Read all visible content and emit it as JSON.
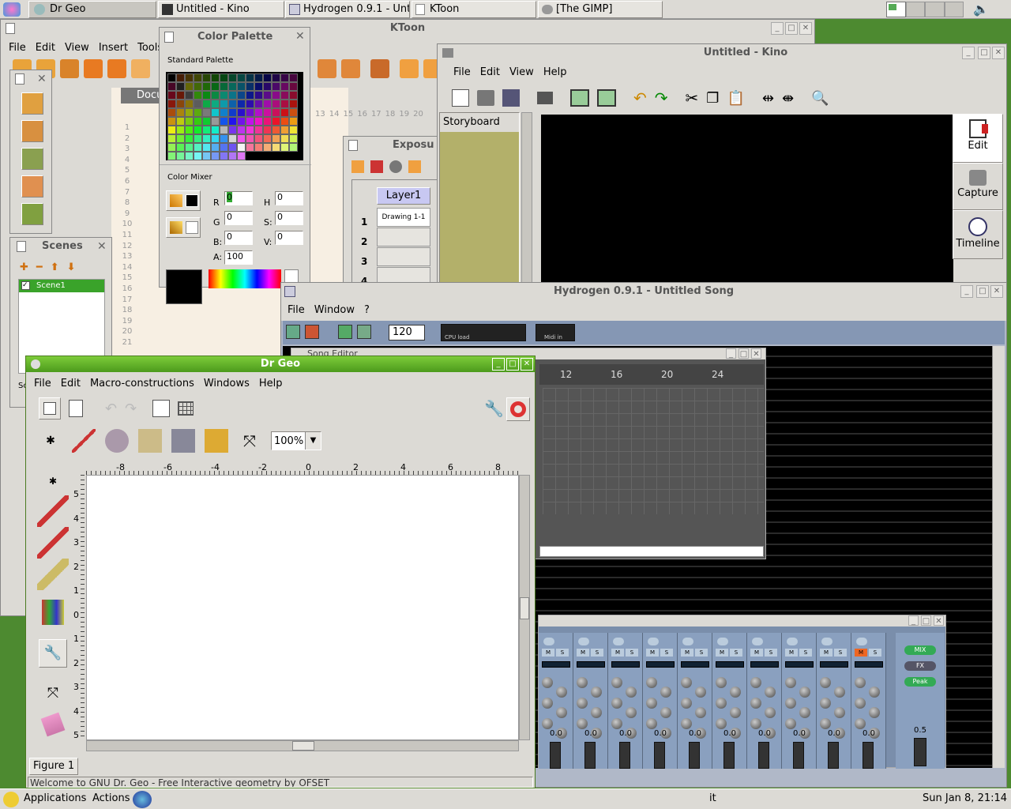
{
  "taskbar": {
    "tasks": [
      "Dr Geo",
      "Untitled - Kino",
      "Hydrogen 0.9.1 - Unt",
      "KToon",
      "[The GIMP]"
    ]
  },
  "ktoon": {
    "title": "KToon",
    "menu": [
      "File",
      "Edit",
      "View",
      "Insert",
      "Tools"
    ],
    "doc_tab": "Docu",
    "scenes_title": "Scenes",
    "scene1": "Scene1",
    "ruler_nums": [
      "1",
      "2",
      "3",
      "4",
      "5",
      "6",
      "7",
      "8",
      "9",
      "10",
      "11",
      "12",
      "13",
      "14",
      "15",
      "16",
      "17",
      "18",
      "19",
      "20",
      "21"
    ],
    "top_nums": [
      "13",
      "14",
      "15",
      "16",
      "17",
      "18",
      "19",
      "20"
    ],
    "exposure_title": "Exposu",
    "layer1": "Layer1",
    "drawing": "Drawing 1-1",
    "rows": [
      "1",
      "2",
      "3",
      "4"
    ],
    "sc": "Sc"
  },
  "palette": {
    "title": "Color Palette",
    "standard": "Standard Palette",
    "mixer": "Color Mixer",
    "r": "R",
    "g": "G",
    "b": "B:",
    "h": "H",
    "s": "S:",
    "v": "V:",
    "a": "A:",
    "r_val": "0",
    "g_val": "0",
    "b_val": "0",
    "h_val": "0",
    "s_val": "0",
    "v_val": "0",
    "a_val": "100",
    "hex": "#000000"
  },
  "kino": {
    "title": "Untitled - Kino",
    "menu": [
      "File",
      "Edit",
      "View",
      "Help"
    ],
    "storyboard": "Storyboard",
    "side": [
      "Edit",
      "Capture",
      "Timeline"
    ]
  },
  "hydrogen": {
    "title": "Hydrogen 0.9.1 - Untitled Song",
    "menu": [
      "File",
      "Window",
      "?"
    ],
    "bpm": "120",
    "cpu": "CPU load",
    "midi": "Midi in",
    "song_editor": "Song Editor",
    "bar_nums": [
      "12",
      "16",
      "20",
      "24"
    ],
    "mixer_vals": [
      "0.0",
      "0.0",
      "0.0",
      "0.0",
      "0.0",
      "0.0",
      "0.0",
      "0.0",
      "0.0",
      "0.0"
    ],
    "master_val": "0.5",
    "mix": "MIX",
    "fx": "FX",
    "peak": "Peak",
    "m": "M",
    "s": "S"
  },
  "drgeo": {
    "title": "Dr Geo",
    "menu": [
      "File",
      "Edit",
      "Macro-constructions",
      "Windows",
      "Help"
    ],
    "zoom": "100%",
    "hruler": [
      "-8",
      "-6",
      "-4",
      "-2",
      "0",
      "2",
      "4",
      "6",
      "8"
    ],
    "vruler": [
      "5",
      "4",
      "3",
      "2",
      "1",
      "0",
      "1",
      "2",
      "3",
      "4",
      "5"
    ],
    "tab": "Figure 1",
    "status": "Welcome to GNU Dr. Geo - Free Interactive geometry by OFSET"
  },
  "bottompanel": {
    "applications": "Applications",
    "actions": "Actions",
    "keyboard": "it",
    "clock": "Sun Jan  8, 21:14"
  }
}
